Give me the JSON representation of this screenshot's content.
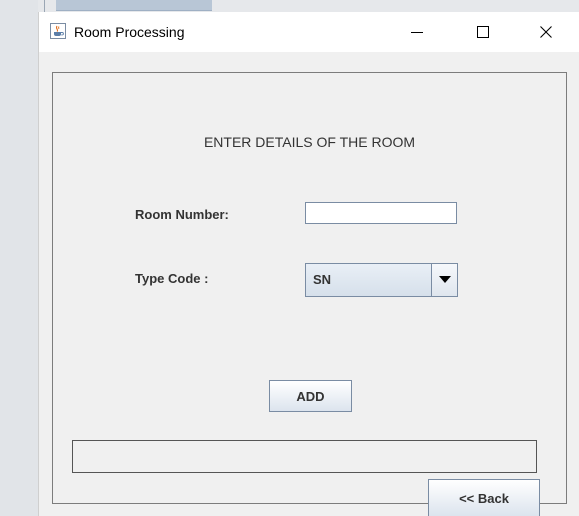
{
  "window": {
    "title": "Room Processing",
    "icon": "java-cup-icon",
    "controls": {
      "minimize": "minimize-icon",
      "maximize": "maximize-icon",
      "close": "close-icon"
    }
  },
  "form": {
    "heading": "ENTER DETAILS OF THE ROOM",
    "room_number_label": "Room Number:",
    "room_number_value": "",
    "type_code_label": "Type Code :",
    "type_code_selected": "SN",
    "add_label": "ADD",
    "status_text": "",
    "back_label": "<< Back"
  },
  "colors": {
    "window_bg": "#f0f0f0",
    "titlebar_bg": "#ffffff",
    "control_border": "#7a8ca3",
    "text": "#333333"
  }
}
